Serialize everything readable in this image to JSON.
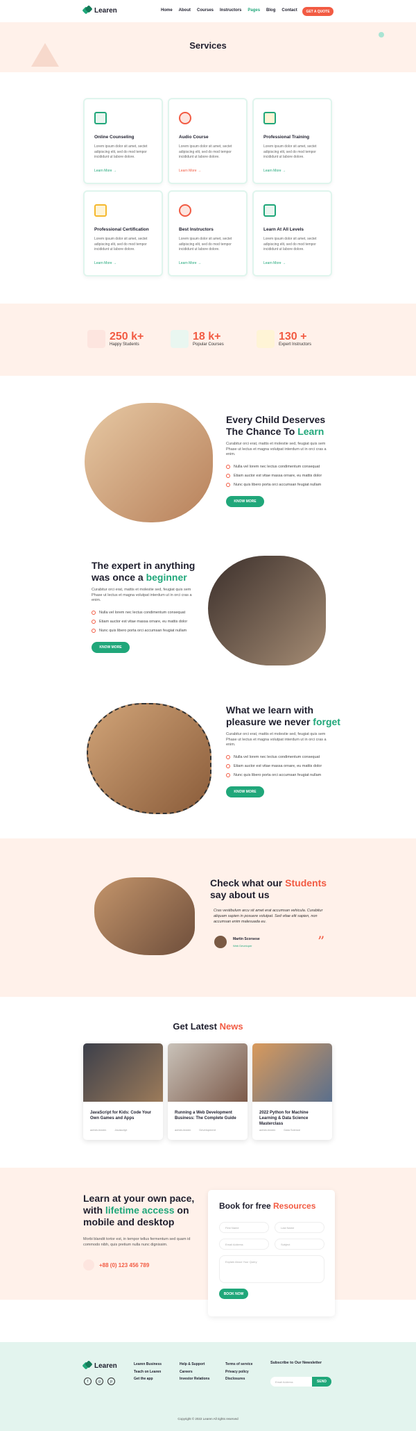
{
  "brand": {
    "name": "Learen"
  },
  "nav": {
    "items": [
      "Home",
      "About",
      "Courses",
      "Instructors",
      "Pages",
      "Blog",
      "Contact"
    ],
    "active": "Pages",
    "cta": "GET A QUOTE"
  },
  "banner": {
    "title": "Services"
  },
  "services": [
    {
      "title": "Online Counseling",
      "desc": "Lorem ipsum dolor sit amet, sectet adipiscing elit, sed do mod tempor incididunt ut labore dolore.",
      "link": "Learn More →"
    },
    {
      "title": "Audio Course",
      "desc": "Lorem ipsum dolor sit amet, sectet adipiscing elit, sed do mod tempor incididunt ut labore dolore.",
      "link": "Learn More →"
    },
    {
      "title": "Professional Training",
      "desc": "Lorem ipsum dolor sit amet, sectet adipiscing elit, sed do mod tempor incididunt ut labore dolore.",
      "link": "Learn More →"
    },
    {
      "title": "Professional Certification",
      "desc": "Lorem ipsum dolor sit amet, sectet adipiscing elit, sed do mod tempor incididunt ut labore dolore.",
      "link": "Learn More →"
    },
    {
      "title": "Best Instructors",
      "desc": "Lorem ipsum dolor sit amet, sectet adipiscing elit, sed do mod tempor incididunt ut labore dolore.",
      "link": "Learn More →"
    },
    {
      "title": "Learn At All Levels",
      "desc": "Lorem ipsum dolor sit amet, sectet adipiscing elit, sed do mod tempor incididunt ut labore dolore.",
      "link": "Learn More →"
    }
  ],
  "stats": [
    {
      "value": "250 k+",
      "label": "Happy Students"
    },
    {
      "value": "18 k+",
      "label": "Popular Courses"
    },
    {
      "value": "130 +",
      "label": "Expert Instructors"
    }
  ],
  "features": [
    {
      "h1": "Every Child Deserves",
      "h2a": "The Chance To ",
      "h2b": "Learn",
      "desc": "Curabitur orci erat, mattis et molestie sed, feugiat quis sem Phase ut lectus et magna volutpat interdum ut in orci cras a enim.",
      "bullets": [
        "Nulla vel lorem nec lectus condimentum consequat",
        "Etiam auctor est vitae massa ornare, eu mattis dolor",
        "Nunc quis libero porta orci accumsan feugiat nullam"
      ],
      "btn": "KNOW MORE"
    },
    {
      "h1": "The expert in anything",
      "h2a": "was once a ",
      "h2b": "beginner",
      "desc": "Curabitur orci erat, mattis et molestie sed, feugiat quis sem Phase ut lectus et magna volutpat interdum ut in orci cras a enim.",
      "bullets": [
        "Nulla vel lorem nec lectus condimentum consequat",
        "Etiam auctor est vitae massa ornare, eu mattis dolor",
        "Nunc quis libero porta orci accumsan feugiat nullam"
      ],
      "btn": "KNOW MORE"
    },
    {
      "h1": "What we learn with",
      "h2a": "pleasure we never ",
      "h2b": "forget",
      "desc": "Curabitur orci erat, mattis et molestie sed, feugiat quis sem Phase ut lectus et magna volutpat interdum ut in orci cras a enim.",
      "bullets": [
        "Nulla vel lorem nec lectus condimentum consequat",
        "Etiam auctor est vitae massa ornare, eu mattis dolor",
        "Nunc quis libero porta orci accumsan feugiat nullam"
      ],
      "btn": "KNOW MORE"
    }
  ],
  "testimonial": {
    "h1a": "Check what our ",
    "h1b": "Students",
    "h2": "say about us",
    "quote": "Cras vestibulum arcu sit amet erat accumsan vehicula. Curabitur aliquam sapien in posuere volutpat. Sed vitae elit sapien, non accumsan enim malesuada eu.",
    "name": "Martin Scorsese",
    "role": "Web Developer"
  },
  "news": {
    "t1": "Get Latest ",
    "t2": "News",
    "items": [
      {
        "title": "JavaScript for Kids: Code Your Own Games and Apps",
        "author": "admin-learen",
        "tag": "Javascript"
      },
      {
        "title": "Running a Web Development Business: The Complete Guide",
        "author": "admin-learen",
        "tag": "Development"
      },
      {
        "title": "2022 Python for Machine Learning & Data Science Masterclass",
        "author": "admin-learen",
        "tag": "Data Science"
      }
    ]
  },
  "cta": {
    "l1": "Learn at your own pace,",
    "l2a": "with ",
    "l2b": "lifetime access",
    "l2c": " on",
    "l3": "mobile and desktop",
    "desc": "Morbi blandit tortor est, in tempor tellus fermentum sed quam id commodo nibh, quis pretium nulla nunc dignissim.",
    "phone": "+88 (0) 123 456 789"
  },
  "form": {
    "t1": "Book for free ",
    "t2": "Resources",
    "first": "First Name",
    "last": "Last Name",
    "email": "Email Address",
    "subject": "Subject",
    "message": "Explain About Your Query",
    "btn": "BOOK NOW"
  },
  "footer": {
    "col1": [
      "Learen Business",
      "Teach on Learen",
      "Get the app"
    ],
    "col2": [
      "Help & Support",
      "Careers",
      "Investor Relations"
    ],
    "col3": [
      "Terms of service",
      "Privacy policy",
      "Disclosures"
    ],
    "nl_title": "Subscribe to Our Newsletter",
    "nl_placeholder": "Email Address",
    "nl_btn": "SEND",
    "copyright": "Copyright © 2022 Learen All rights reserved"
  },
  "colors": {
    "accent": "#20a77a",
    "orange": "#f25b43",
    "peach": "#fff1ea",
    "mint": "#e3f4ee"
  }
}
